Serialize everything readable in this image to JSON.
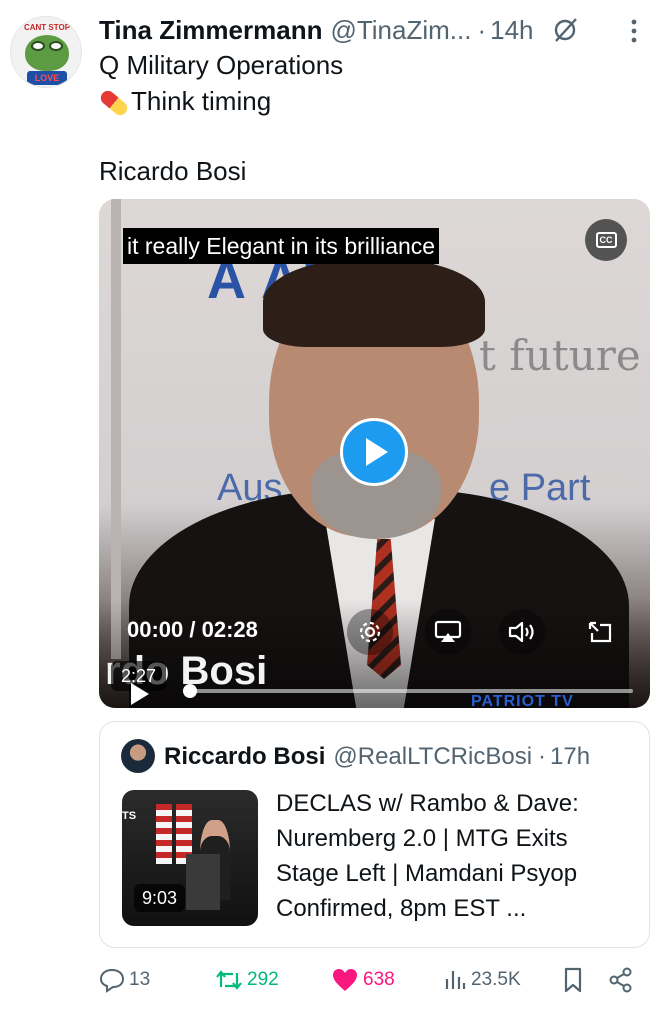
{
  "tweet": {
    "author_name": "Tina Zimmermann",
    "handle": "@TinaZim...",
    "dot": "·",
    "time": "14h",
    "avatar_text_top": "CANT STOP",
    "avatar_text_bottom": "LOVE",
    "lines": [
      "Q Military Operations",
      "Think timing",
      "Ricardo Bosi"
    ]
  },
  "video": {
    "subtitle": "it really Elegant in its brilliance",
    "cc_label": "CC",
    "timecode": "00:00 / 02:28",
    "duration_badge": "2:27",
    "lower_third": "rdo Bosi",
    "bg_text_1": "A    ALIAO",
    "bg_text_2": "t future",
    "bg_text_3": "Aus",
    "bg_text_4": "e Part",
    "watermark": "PATRIOT TV"
  },
  "quote": {
    "author_name": "Riccardo Bosi",
    "handle": "@RealLTCRicBosi",
    "dot": "·",
    "time": "17h",
    "thumb_duration": "9:03",
    "thumb_tag": "TS",
    "text_lines": [
      "DECLAS w/ Rambo & Dave:",
      "Nuremberg 2.0 | MTG Exits",
      "Stage Left | Mamdani Psyop",
      "Confirmed, 8pm EST ..."
    ]
  },
  "actions": {
    "replies": "13",
    "reposts": "292",
    "likes": "638",
    "views": "23.5K"
  },
  "colors": {
    "accent": "#1d9bf0",
    "muted": "#536471",
    "repost": "#00ba7c",
    "like": "#f91880"
  }
}
